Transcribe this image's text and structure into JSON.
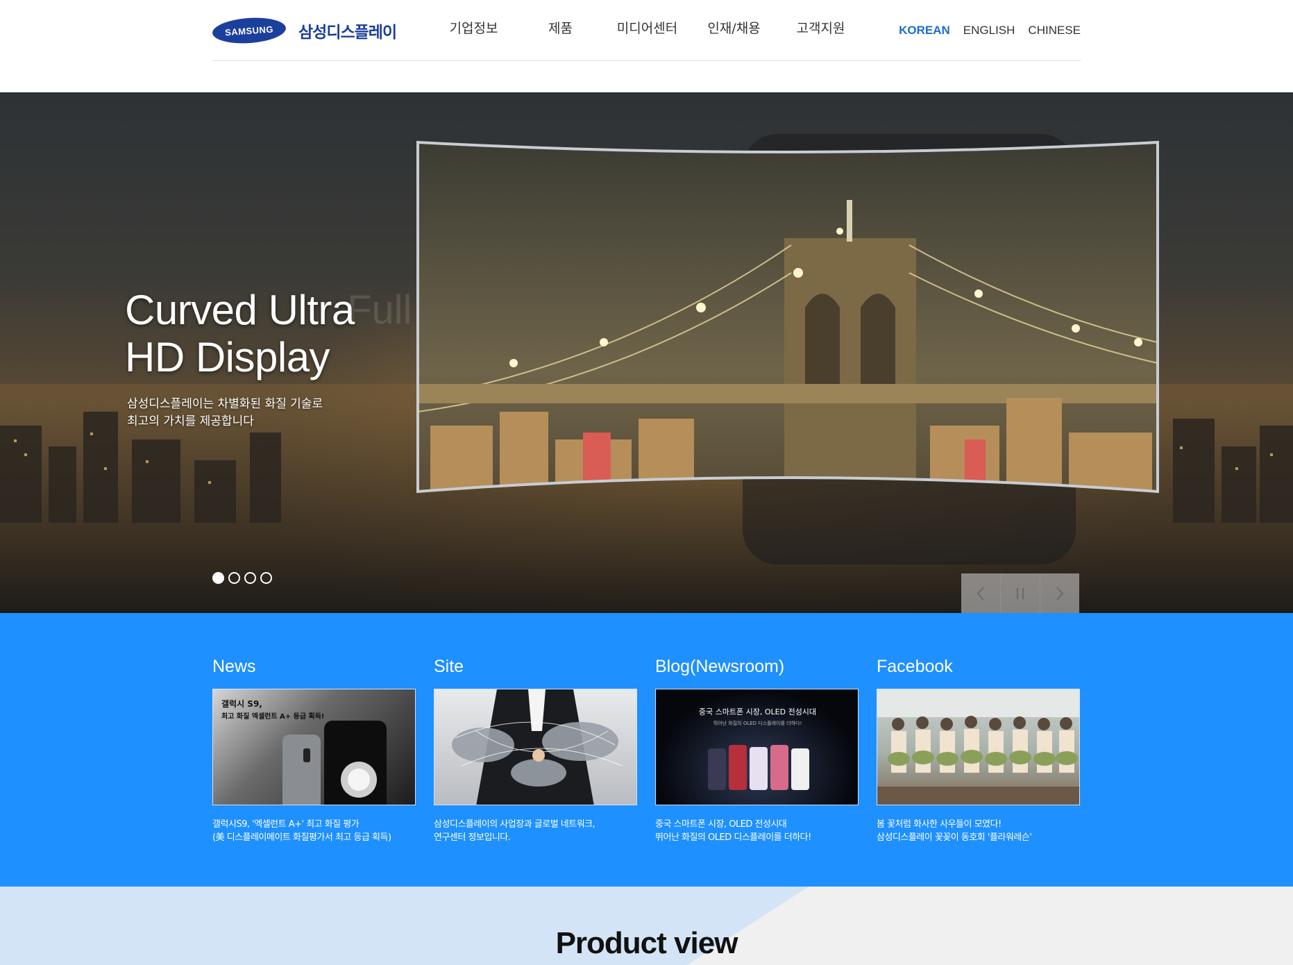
{
  "header": {
    "logo_mark": "SAMSUNG",
    "logo_text": "삼성디스플레이",
    "nav": [
      "기업정보",
      "제품",
      "미디어센터",
      "인재/채용",
      "고객지원"
    ],
    "languages": [
      "KOREAN",
      "ENGLISH",
      "CHINESE"
    ],
    "active_language": "KOREAN"
  },
  "hero": {
    "title_line1": "Curved Ultra",
    "title_line2": "HD Display",
    "ghost_text": "Full Screen Dual Edge",
    "subtitle_line1": "삼성디스플레이는 차별화된 화질 기술로",
    "subtitle_line2": "최고의 가치를 제공합니다",
    "slides_total": 4,
    "active_slide": 1,
    "controls": {
      "prev_icon": "chevron-left-icon",
      "pause_icon": "pause-icon",
      "next_icon": "chevron-right-icon"
    }
  },
  "cards": [
    {
      "title": "News",
      "thumb_caption1": "갤럭시 S9,",
      "thumb_caption2": "최고 화질 엑셀런트 A+ 등급 획득!",
      "line1": "갤럭시S9, '엑셀런트 A+' 최고 화질 평가",
      "line2": "(美 디스플레이메이트 화질평가서 최고 등급 획득)"
    },
    {
      "title": "Site",
      "line1": "삼성디스플레이의 사업장과 글로벌 네트워크,",
      "line2": "연구센터 정보입니다."
    },
    {
      "title": "Blog(Newsroom)",
      "thumb_caption1": "중국 스마트폰 시장, OLED 전성시대",
      "thumb_caption2": "뛰어난 화질의 OLED 디스플레이를 더하다!",
      "line1": "중국 스마트폰 시장, OLED 전성시대",
      "line2": "뛰어난 화질의 OLED 디스플레이를 더하다!"
    },
    {
      "title": "Facebook",
      "line1": "봄 꽃처럼 화사한 사우들이 모였다!",
      "line2": "삼성디스플레이 꽃꽂이 동호회 '플라워레슨'"
    }
  ],
  "product": {
    "title": "Product view"
  },
  "colors": {
    "brand_blue": "#1b3f9c",
    "accent_blue": "#1e90ff",
    "active_language": "#1a6ecb"
  }
}
